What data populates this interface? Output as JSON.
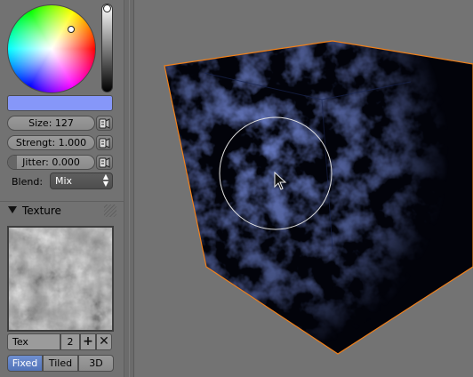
{
  "brush": {
    "color_hex": "#8697f9",
    "size_label": "Size: 127",
    "strength_label": "Strengt: 1.000",
    "jitter_label": "Jitter: 0.000",
    "blend_label": "Blend:",
    "blend_value": "Mix"
  },
  "texture_panel": {
    "title": "Texture",
    "texture_name": "Tex",
    "user_count": "2",
    "mapping_modes": [
      "Fixed",
      "Tiled",
      "3D"
    ],
    "active_mode": "Fixed"
  },
  "colors": {
    "selection_outline": "#f0801a",
    "volume_blue": "#3a4a9a",
    "active_button": "#5a7cc4"
  },
  "icons": [
    "pen-pressure-icon",
    "disclosure-triangle-icon",
    "add-icon",
    "unlink-icon",
    "mouse-cursor-icon",
    "brush-circle-icon"
  ]
}
